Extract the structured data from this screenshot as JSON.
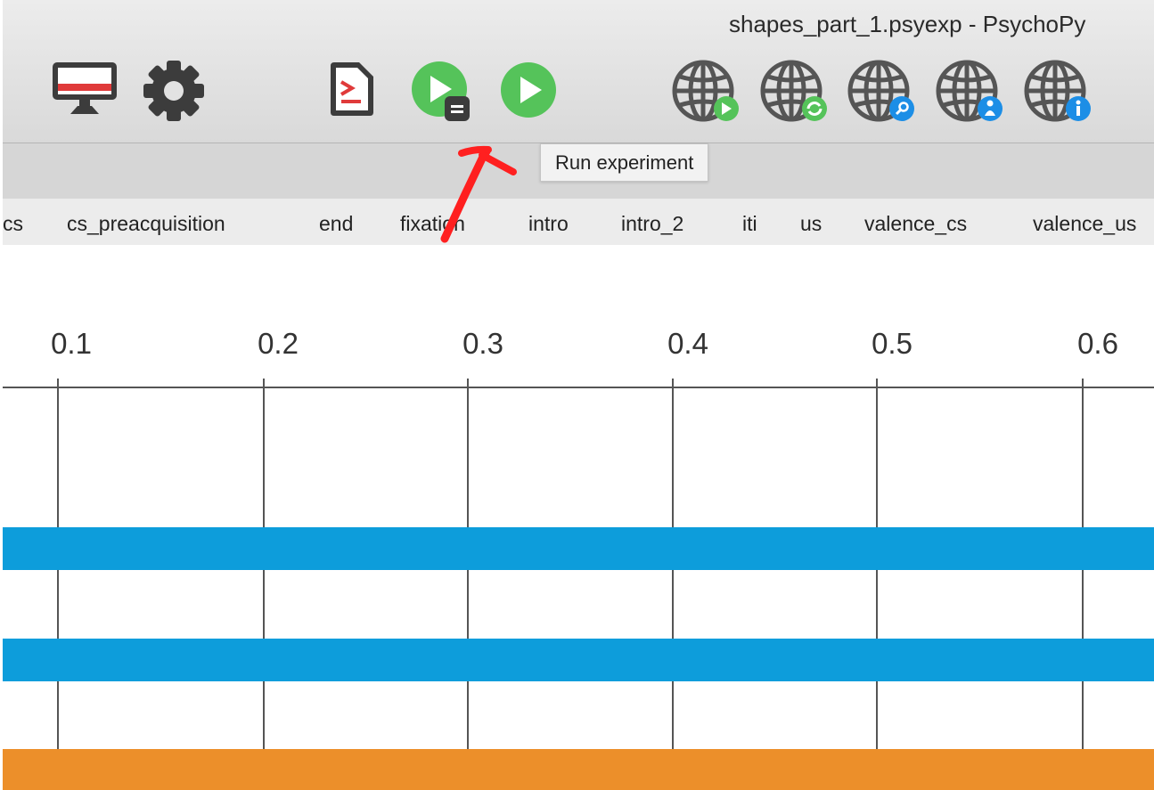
{
  "window": {
    "title": "shapes_part_1.psyexp - PsychoPy"
  },
  "toolbar": {
    "icons": [
      {
        "name": "monitor-center-icon"
      },
      {
        "name": "preferences-gear-icon"
      },
      {
        "name": "compile-script-icon"
      },
      {
        "name": "run-with-runner-icon"
      },
      {
        "name": "run-experiment-icon"
      },
      {
        "name": "run-online-icon"
      },
      {
        "name": "sync-online-icon"
      },
      {
        "name": "search-online-icon"
      },
      {
        "name": "user-info-icon"
      },
      {
        "name": "project-info-icon"
      }
    ]
  },
  "tooltip": {
    "text": "Run experiment"
  },
  "routine_tabs": [
    "cs",
    "cs_preacquisition",
    "end",
    "fixation",
    "intro",
    "intro_2",
    "iti",
    "us",
    "valence_cs",
    "valence_us"
  ],
  "timeline": {
    "ticks": [
      "0.1",
      "0.2",
      "0.3",
      "0.4",
      "0.5",
      "0.6"
    ],
    "components": [
      {
        "color": "#0d9ddb"
      },
      {
        "color": "#0d9ddb"
      },
      {
        "color": "#ec8f2a"
      }
    ]
  },
  "colors": {
    "run_green": "#55c35a",
    "globe_gray": "#555555",
    "accent_blue": "#1c8ee6",
    "annotation_red": "#ff2020"
  }
}
